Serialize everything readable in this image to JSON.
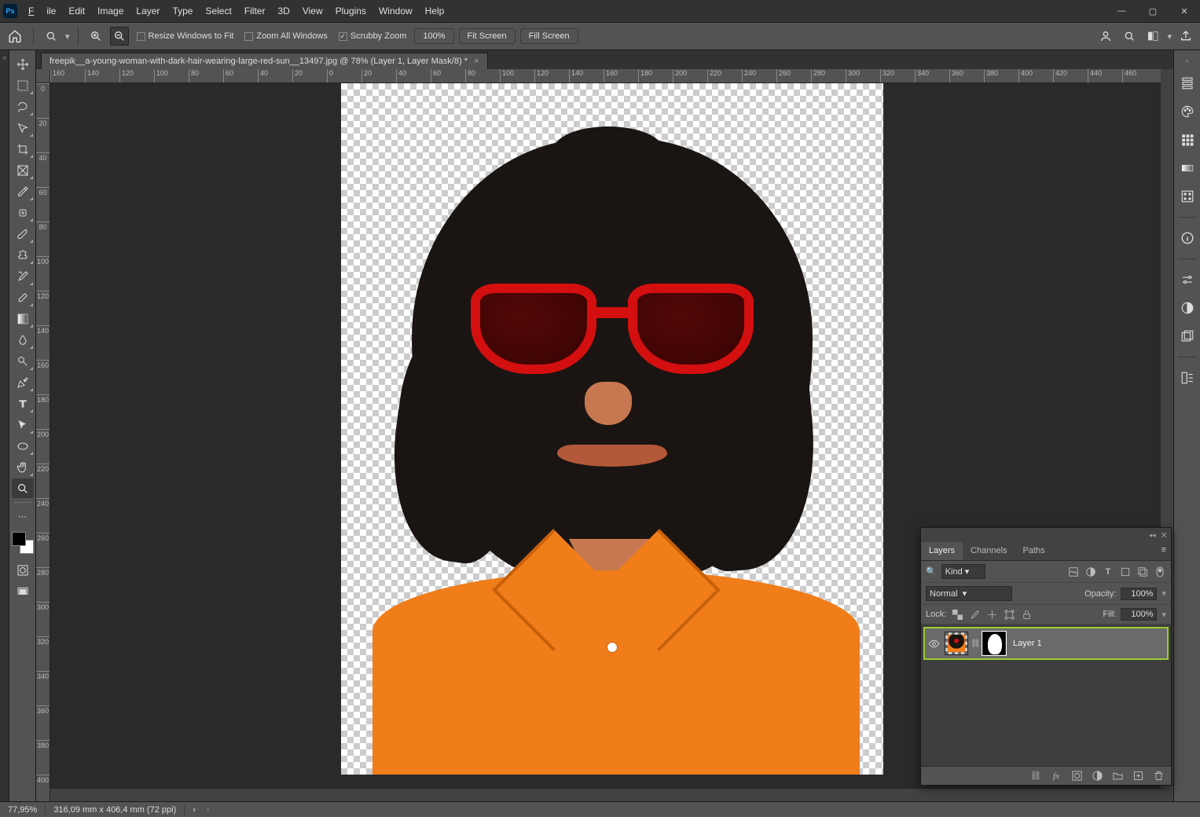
{
  "menu": {
    "file": "File",
    "edit": "Edit",
    "image": "Image",
    "layer": "Layer",
    "type": "Type",
    "select": "Select",
    "filter": "Filter",
    "threeD": "3D",
    "view": "View",
    "plugins": "Plugins",
    "window": "Window",
    "help": "Help"
  },
  "options": {
    "resize_windows": "Resize Windows to Fit",
    "zoom_all": "Zoom All Windows",
    "scrubby": "Scrubby Zoom",
    "zoom_100": "100%",
    "fit_screen": "Fit Screen",
    "fill_screen": "Fill Screen"
  },
  "doc": {
    "tab_title": "freepik__a-young-woman-with-dark-hair-wearing-large-red-sun__13497.jpg @ 78% (Layer 1, Layer Mask/8) *"
  },
  "ruler_h": [
    "160",
    "140",
    "120",
    "100",
    "80",
    "60",
    "40",
    "20",
    "0",
    "20",
    "40",
    "60",
    "80",
    "100",
    "120",
    "140",
    "160",
    "180",
    "200",
    "220",
    "240",
    "260",
    "280",
    "300",
    "320",
    "340",
    "360",
    "380",
    "400",
    "420",
    "440",
    "460"
  ],
  "ruler_v": [
    "0",
    "20",
    "40",
    "60",
    "80",
    "100",
    "120",
    "140",
    "160",
    "180",
    "200",
    "220",
    "240",
    "260",
    "280",
    "300",
    "320",
    "340",
    "360",
    "380",
    "400"
  ],
  "status": {
    "zoom": "77,95%",
    "doc_info": "316,09 mm x 406,4 mm (72 ppi)"
  },
  "layers_panel": {
    "tabs": {
      "layers": "Layers",
      "channels": "Channels",
      "paths": "Paths"
    },
    "kind_label": "Kind",
    "blend_mode": "Normal",
    "opacity_label": "Opacity:",
    "opacity_value": "100%",
    "lock_label": "Lock:",
    "fill_label": "Fill:",
    "fill_value": "100%",
    "layer_name": "Layer 1"
  }
}
